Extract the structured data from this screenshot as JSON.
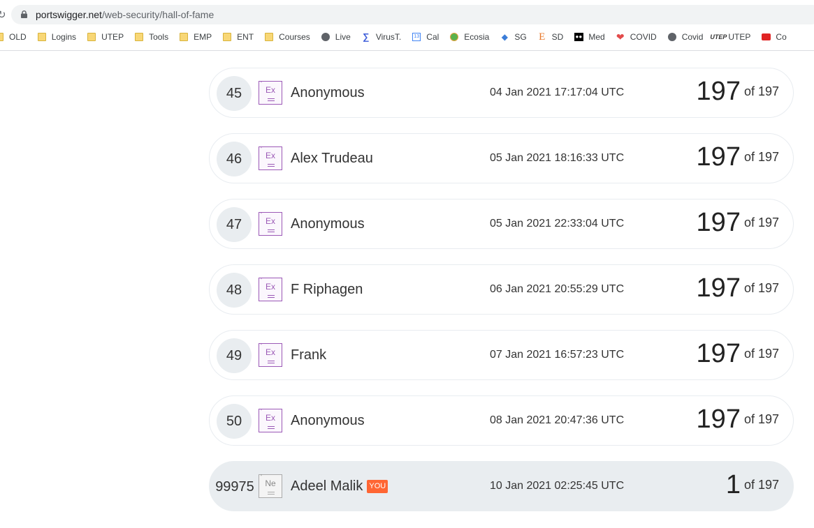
{
  "browser": {
    "url_domain": "portswigger.net",
    "url_path": "/web-security/hall-of-fame",
    "bookmarks": [
      {
        "label": "OLD",
        "icon": "folder"
      },
      {
        "label": "Logins",
        "icon": "folder"
      },
      {
        "label": "UTEP",
        "icon": "folder"
      },
      {
        "label": "Tools",
        "icon": "folder"
      },
      {
        "label": "EMP",
        "icon": "folder"
      },
      {
        "label": "ENT",
        "icon": "folder"
      },
      {
        "label": "Courses",
        "icon": "folder"
      },
      {
        "label": "Live",
        "icon": "globe"
      },
      {
        "label": "VirusT.",
        "icon": "virustotal"
      },
      {
        "label": "Cal",
        "icon": "calendar"
      },
      {
        "label": "Ecosia",
        "icon": "ecosia"
      },
      {
        "label": "SG",
        "icon": "sg"
      },
      {
        "label": "SD",
        "icon": "sd"
      },
      {
        "label": "Med",
        "icon": "medium"
      },
      {
        "label": "COVID",
        "icon": "heart"
      },
      {
        "label": "Covid",
        "icon": "globe"
      },
      {
        "label": "UTEP",
        "icon": "utep"
      },
      {
        "label": "Co",
        "icon": "bus"
      }
    ]
  },
  "leaderboard": {
    "rows": [
      {
        "rank": "45",
        "badge": "Ex",
        "name": "Anonymous",
        "date": "04 Jan 2021 17:17:04 UTC",
        "score": "197",
        "of": "of 197"
      },
      {
        "rank": "46",
        "badge": "Ex",
        "name": "Alex Trudeau",
        "date": "05 Jan 2021 18:16:33 UTC",
        "score": "197",
        "of": "of 197"
      },
      {
        "rank": "47",
        "badge": "Ex",
        "name": "Anonymous",
        "date": "05 Jan 2021 22:33:04 UTC",
        "score": "197",
        "of": "of 197"
      },
      {
        "rank": "48",
        "badge": "Ex",
        "name": "F Riphagen",
        "date": "06 Jan 2021 20:55:29 UTC",
        "score": "197",
        "of": "of 197"
      },
      {
        "rank": "49",
        "badge": "Ex",
        "name": "Frank",
        "date": "07 Jan 2021 16:57:23 UTC",
        "score": "197",
        "of": "of 197"
      },
      {
        "rank": "50",
        "badge": "Ex",
        "name": "Anonymous",
        "date": "08 Jan 2021 20:47:36 UTC",
        "score": "197",
        "of": "of 197"
      }
    ],
    "current_user": {
      "rank": "99975",
      "badge": "Ne",
      "name": "Adeel Malik",
      "tag": "YOU",
      "date": "10 Jan 2021 02:25:45 UTC",
      "score": "1",
      "of": "of 197"
    }
  },
  "colors": {
    "accent_expert": "#9b59b6",
    "you_tag": "#ff6633",
    "rank_bg": "#e9edf0"
  }
}
